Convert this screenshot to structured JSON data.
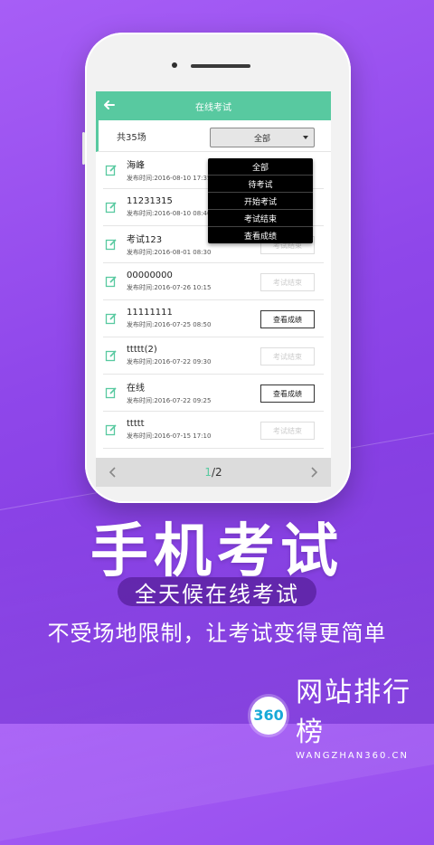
{
  "colors": {
    "accent": "#58c9a0",
    "background": "#8f47ea"
  },
  "app": {
    "title": "在线考试"
  },
  "filter": {
    "count_label": "共35场",
    "selected": "全部"
  },
  "dropdown": {
    "options": [
      "全部",
      "待考试",
      "开始考试",
      "考试结束",
      "查看成绩"
    ]
  },
  "exams": [
    {
      "name": "海峰",
      "time": "发布时间:2016-08-10 17:35",
      "action": ""
    },
    {
      "name": "11231315",
      "time": "发布时间:2016-08-10 08:40",
      "action": ""
    },
    {
      "name": "考试123",
      "time": "发布时间:2016-08-01 08:30",
      "action": "考试结束"
    },
    {
      "name": "00000000",
      "time": "发布时间:2016-07-26 10:15",
      "action": "考试结束"
    },
    {
      "name": "11111111",
      "time": "发布时间:2016-07-25 08:50",
      "action": "查看成绩"
    },
    {
      "name": "ttttt(2)",
      "time": "发布时间:2016-07-22 09:30",
      "action": "考试结束"
    },
    {
      "name": "在线",
      "time": "发布时间:2016-07-22 09:25",
      "action": "查看成绩"
    },
    {
      "name": "ttttt",
      "time": "发布时间:2016-07-15 17:10",
      "action": "考试结束"
    }
  ],
  "pager": {
    "current": "1",
    "total": "/2"
  },
  "promo": {
    "headline": "手机考试",
    "pill": "全天候在线考试",
    "tagline": "不受场地限制，让考试变得更简单"
  },
  "brand": {
    "logo_text": "360",
    "name": "网站排行榜",
    "sub": "WANGZHAN360.CN"
  }
}
